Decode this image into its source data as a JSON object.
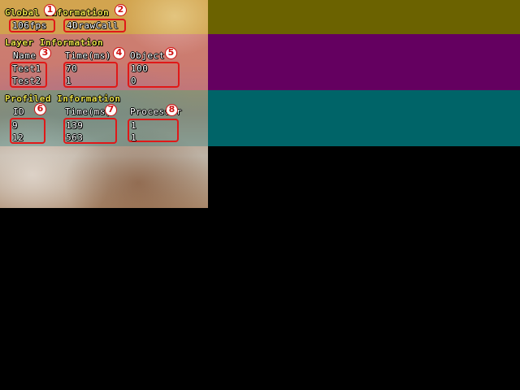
{
  "colors": {
    "global_band": "#6b6200",
    "layer_band": "#640060",
    "profiled_band": "#006468",
    "highlight": "#e01818",
    "header_text": "#e8e048"
  },
  "global": {
    "title": "Global Information",
    "fps": "106fps",
    "drawcall": "4DrawCall"
  },
  "layer": {
    "title": "Layer Information",
    "col_name": "Name",
    "col_time": "Time(ms)",
    "col_object": "Object",
    "names": [
      "Test1",
      "Test2"
    ],
    "times": [
      "70",
      "1"
    ],
    "objects": [
      "100",
      "0"
    ]
  },
  "profiled": {
    "title": "Profiled Information",
    "col_id": "ID",
    "col_time": "Time(ms)",
    "col_processor": "Processor",
    "ids": [
      "9",
      "12"
    ],
    "times": [
      "139",
      "563"
    ],
    "processors": [
      "1",
      "1"
    ]
  },
  "markers": [
    "1",
    "2",
    "3",
    "4",
    "5",
    "6",
    "7",
    "8"
  ]
}
